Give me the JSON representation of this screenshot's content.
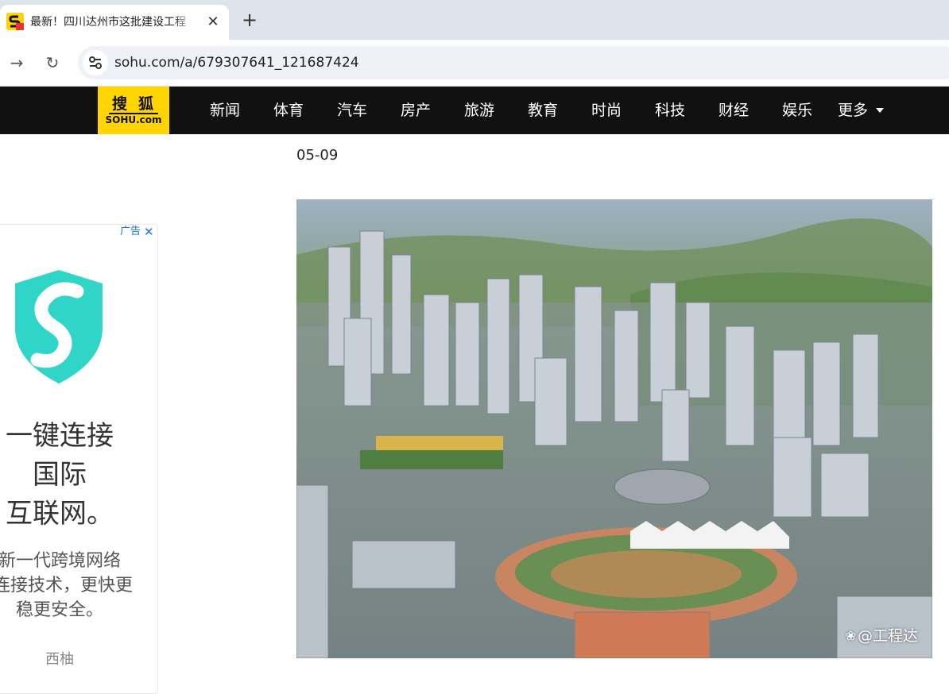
{
  "browser": {
    "tab": {
      "title": "最新！四川达州市这批建设工程",
      "close_glyph": "✕"
    },
    "new_tab_glyph": "+",
    "forward_glyph": "→",
    "reload_glyph": "↻",
    "url": "sohu.com/a/679307641_121687424"
  },
  "site": {
    "logo_cn": "搜狐",
    "logo_en": "SOHU.com",
    "nav_items": [
      "新闻",
      "体育",
      "汽车",
      "房产",
      "旅游",
      "教育",
      "时尚",
      "科技",
      "财经",
      "娱乐"
    ],
    "nav_more": "更多"
  },
  "article": {
    "date": "05-09",
    "image_watermark": "@工程达"
  },
  "ad": {
    "label": "广告",
    "close_glyph": "✕",
    "headline_lines": [
      "一键连接",
      "国际",
      "互联网。"
    ],
    "desc_lines": [
      "新一代跨境网络",
      "连接技术，更快更",
      "稳更安全。"
    ],
    "brand": "西柚"
  },
  "colors": {
    "sohu_yellow": "#ffd400",
    "nav_black": "#111111",
    "shield_teal": "#2fd6c8",
    "link_blue": "#1a73e8"
  }
}
